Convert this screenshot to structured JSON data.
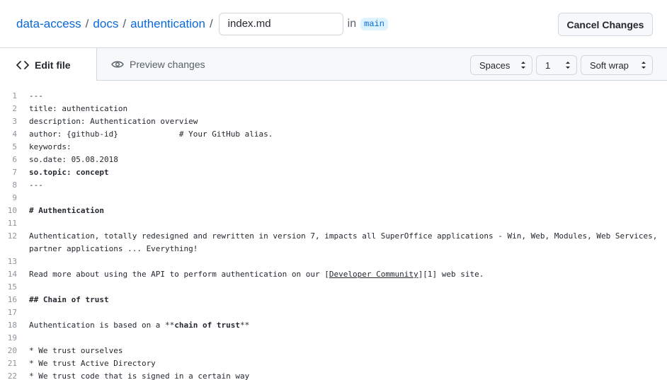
{
  "breadcrumb": {
    "repo": "data-access",
    "folder1": "docs",
    "folder2": "authentication",
    "separator": "/"
  },
  "filename_input": {
    "value": "index.md"
  },
  "in_label": "in",
  "branch": "main",
  "cancel_button": "Cancel Changes",
  "tabs": {
    "edit": "Edit file",
    "preview": "Preview changes"
  },
  "editor_options": {
    "indent_mode": "Spaces",
    "indent_size": "1",
    "wrap_mode": "Soft wrap"
  },
  "code_lines": [
    {
      "n": "1",
      "t": "---"
    },
    {
      "n": "2",
      "t": "title: authentication"
    },
    {
      "n": "3",
      "t": "description: Authentication overview"
    },
    {
      "n": "4",
      "t": "author: {github-id}             # Your GitHub alias."
    },
    {
      "n": "5",
      "t": "keywords:"
    },
    {
      "n": "6",
      "t": "so.date: 05.08.2018"
    },
    {
      "n": "7",
      "t": "so.topic: concept",
      "bold": true
    },
    {
      "n": "8",
      "t": "---"
    },
    {
      "n": "9",
      "t": ""
    },
    {
      "n": "10",
      "t": "# Authentication",
      "bold": true
    },
    {
      "n": "11",
      "t": ""
    },
    {
      "n": "12",
      "t": "Authentication, totally redesigned and rewritten in version 7, impacts all SuperOffice applications - Win, Web, Modules, Web Services,"
    },
    {
      "n": "",
      "t": "partner applications ... Everything!"
    },
    {
      "n": "13",
      "t": ""
    },
    {
      "n": "14",
      "pre": "Read more about using the API to perform authentication on our [",
      "link": "Developer Community",
      "post": "][1] web site."
    },
    {
      "n": "15",
      "t": ""
    },
    {
      "n": "16",
      "t": "## Chain of trust",
      "bold": true
    },
    {
      "n": "17",
      "t": ""
    },
    {
      "n": "18",
      "pre": "Authentication is based on a **",
      "strong": "chain of trust",
      "post": "**"
    },
    {
      "n": "19",
      "t": ""
    },
    {
      "n": "20",
      "t": "* We trust ourselves"
    },
    {
      "n": "21",
      "t": "* We trust Active Directory"
    },
    {
      "n": "22",
      "t": "* We trust code that is signed in a certain way"
    }
  ]
}
